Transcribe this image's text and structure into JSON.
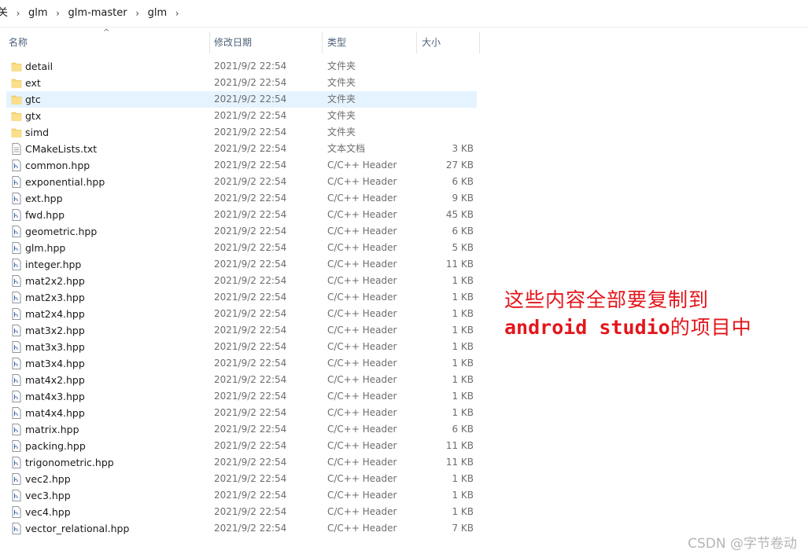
{
  "breadcrumb": {
    "items": [
      "关",
      "glm",
      "glm-master",
      "glm"
    ],
    "separator_icon": "chevron-right-icon"
  },
  "columns": {
    "name": "名称",
    "date": "修改日期",
    "type": "类型",
    "size": "大小",
    "sort_indicator": "^"
  },
  "files": [
    {
      "name": "detail",
      "date": "2021/9/2 22:54",
      "type": "文件夹",
      "size": "",
      "icon": "folder-icon"
    },
    {
      "name": "ext",
      "date": "2021/9/2 22:54",
      "type": "文件夹",
      "size": "",
      "icon": "folder-icon"
    },
    {
      "name": "gtc",
      "date": "2021/9/2 22:54",
      "type": "文件夹",
      "size": "",
      "icon": "folder-icon",
      "selected": true
    },
    {
      "name": "gtx",
      "date": "2021/9/2 22:54",
      "type": "文件夹",
      "size": "",
      "icon": "folder-icon"
    },
    {
      "name": "simd",
      "date": "2021/9/2 22:54",
      "type": "文件夹",
      "size": "",
      "icon": "folder-icon"
    },
    {
      "name": "CMakeLists.txt",
      "date": "2021/9/2 22:54",
      "type": "文本文档",
      "size": "3 KB",
      "icon": "text-file-icon"
    },
    {
      "name": "common.hpp",
      "date": "2021/9/2 22:54",
      "type": "C/C++ Header",
      "size": "27 KB",
      "icon": "header-file-icon"
    },
    {
      "name": "exponential.hpp",
      "date": "2021/9/2 22:54",
      "type": "C/C++ Header",
      "size": "6 KB",
      "icon": "header-file-icon"
    },
    {
      "name": "ext.hpp",
      "date": "2021/9/2 22:54",
      "type": "C/C++ Header",
      "size": "9 KB",
      "icon": "header-file-icon"
    },
    {
      "name": "fwd.hpp",
      "date": "2021/9/2 22:54",
      "type": "C/C++ Header",
      "size": "45 KB",
      "icon": "header-file-icon"
    },
    {
      "name": "geometric.hpp",
      "date": "2021/9/2 22:54",
      "type": "C/C++ Header",
      "size": "6 KB",
      "icon": "header-file-icon"
    },
    {
      "name": "glm.hpp",
      "date": "2021/9/2 22:54",
      "type": "C/C++ Header",
      "size": "5 KB",
      "icon": "header-file-icon"
    },
    {
      "name": "integer.hpp",
      "date": "2021/9/2 22:54",
      "type": "C/C++ Header",
      "size": "11 KB",
      "icon": "header-file-icon"
    },
    {
      "name": "mat2x2.hpp",
      "date": "2021/9/2 22:54",
      "type": "C/C++ Header",
      "size": "1 KB",
      "icon": "header-file-icon"
    },
    {
      "name": "mat2x3.hpp",
      "date": "2021/9/2 22:54",
      "type": "C/C++ Header",
      "size": "1 KB",
      "icon": "header-file-icon"
    },
    {
      "name": "mat2x4.hpp",
      "date": "2021/9/2 22:54",
      "type": "C/C++ Header",
      "size": "1 KB",
      "icon": "header-file-icon"
    },
    {
      "name": "mat3x2.hpp",
      "date": "2021/9/2 22:54",
      "type": "C/C++ Header",
      "size": "1 KB",
      "icon": "header-file-icon"
    },
    {
      "name": "mat3x3.hpp",
      "date": "2021/9/2 22:54",
      "type": "C/C++ Header",
      "size": "1 KB",
      "icon": "header-file-icon"
    },
    {
      "name": "mat3x4.hpp",
      "date": "2021/9/2 22:54",
      "type": "C/C++ Header",
      "size": "1 KB",
      "icon": "header-file-icon"
    },
    {
      "name": "mat4x2.hpp",
      "date": "2021/9/2 22:54",
      "type": "C/C++ Header",
      "size": "1 KB",
      "icon": "header-file-icon"
    },
    {
      "name": "mat4x3.hpp",
      "date": "2021/9/2 22:54",
      "type": "C/C++ Header",
      "size": "1 KB",
      "icon": "header-file-icon"
    },
    {
      "name": "mat4x4.hpp",
      "date": "2021/9/2 22:54",
      "type": "C/C++ Header",
      "size": "1 KB",
      "icon": "header-file-icon"
    },
    {
      "name": "matrix.hpp",
      "date": "2021/9/2 22:54",
      "type": "C/C++ Header",
      "size": "6 KB",
      "icon": "header-file-icon"
    },
    {
      "name": "packing.hpp",
      "date": "2021/9/2 22:54",
      "type": "C/C++ Header",
      "size": "11 KB",
      "icon": "header-file-icon"
    },
    {
      "name": "trigonometric.hpp",
      "date": "2021/9/2 22:54",
      "type": "C/C++ Header",
      "size": "11 KB",
      "icon": "header-file-icon"
    },
    {
      "name": "vec2.hpp",
      "date": "2021/9/2 22:54",
      "type": "C/C++ Header",
      "size": "1 KB",
      "icon": "header-file-icon"
    },
    {
      "name": "vec3.hpp",
      "date": "2021/9/2 22:54",
      "type": "C/C++ Header",
      "size": "1 KB",
      "icon": "header-file-icon"
    },
    {
      "name": "vec4.hpp",
      "date": "2021/9/2 22:54",
      "type": "C/C++ Header",
      "size": "1 KB",
      "icon": "header-file-icon"
    },
    {
      "name": "vector_relational.hpp",
      "date": "2021/9/2 22:54",
      "type": "C/C++ Header",
      "size": "7 KB",
      "icon": "header-file-icon"
    }
  ],
  "annotation": {
    "line1": "这些内容全部要复制到",
    "line2_code": "android studio",
    "line2_text": "的项目中",
    "color": "#e3161b"
  },
  "watermark": "CSDN @字节卷动",
  "colors": {
    "selection": "#e5f3ff",
    "folder": "#f8d775",
    "header_text": "#4c607a"
  }
}
